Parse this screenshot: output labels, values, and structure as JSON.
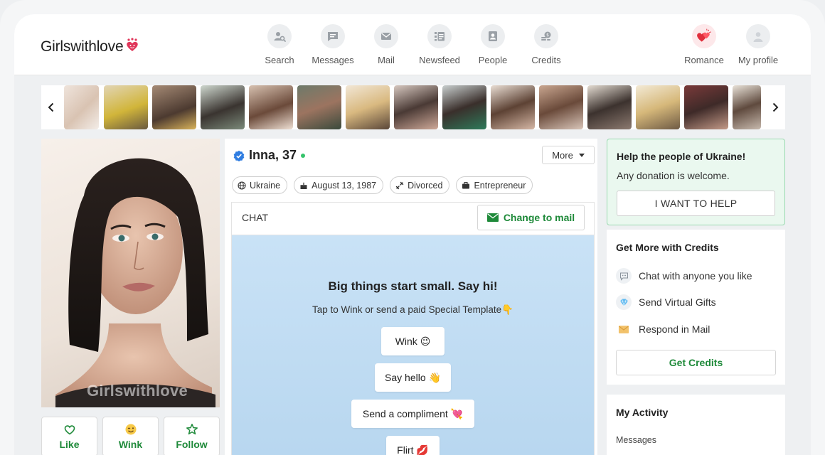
{
  "brand": {
    "logo_text": "Girlswithlove",
    "accent": "#1f8a3a",
    "heart_color": "#e0365a"
  },
  "nav": {
    "items": [
      {
        "label": "Search",
        "icon": "search-user-icon"
      },
      {
        "label": "Messages",
        "icon": "chat-bubble-icon"
      },
      {
        "label": "Mail",
        "icon": "envelope-icon"
      },
      {
        "label": "Newsfeed",
        "icon": "newsfeed-icon"
      },
      {
        "label": "People",
        "icon": "people-card-icon"
      },
      {
        "label": "Credits",
        "icon": "coins-icon"
      }
    ],
    "right": [
      {
        "label": "Romance",
        "icon": "hearts-icon"
      },
      {
        "label": "My profile",
        "icon": "avatar-icon"
      }
    ]
  },
  "carousel": {
    "prev_icon": "chevron-left-icon",
    "next_icon": "chevron-right-icon",
    "thumbnail_count": 15
  },
  "photo": {
    "watermark": "Girlswithlove"
  },
  "actions": [
    {
      "label": "Like",
      "icon": "heart-outline-icon"
    },
    {
      "label": "Wink",
      "icon": "wink-emoji-icon"
    },
    {
      "label": "Follow",
      "icon": "star-outline-icon"
    }
  ],
  "profile": {
    "name": "Inna, 37",
    "verified_icon": "verified-badge-icon",
    "online_color": "#35c36b",
    "more_label": "More",
    "chips": [
      {
        "label": "Ukraine",
        "icon": "globe-icon"
      },
      {
        "label": "August 13, 1987",
        "icon": "cake-icon"
      },
      {
        "label": "Divorced",
        "icon": "broken-link-icon"
      },
      {
        "label": "Entrepreneur",
        "icon": "briefcase-icon"
      }
    ]
  },
  "chat": {
    "title": "CHAT",
    "change_mail_label": "Change to mail",
    "heading": "Big things start small. Say hi!",
    "sub": "Tap to Wink or send a paid Special Template👇",
    "options": [
      "Wink 😉",
      "Say hello 👋",
      "Send a compliment 💘",
      "Flirt 💋"
    ]
  },
  "ukraine": {
    "title": "Help the people of Ukraine!",
    "subtitle": "Any donation is welcome.",
    "button": "I WANT TO HELP"
  },
  "credits": {
    "title": "Get More with Credits",
    "items": [
      {
        "label": "Chat with anyone you like",
        "icon": "speech-bubble-icon"
      },
      {
        "label": "Send Virtual Gifts",
        "icon": "diamond-icon"
      },
      {
        "label": "Respond in Mail",
        "icon": "envelope-icon"
      }
    ],
    "button": "Get Credits"
  },
  "activity": {
    "title": "My Activity",
    "items": [
      "Messages"
    ]
  }
}
